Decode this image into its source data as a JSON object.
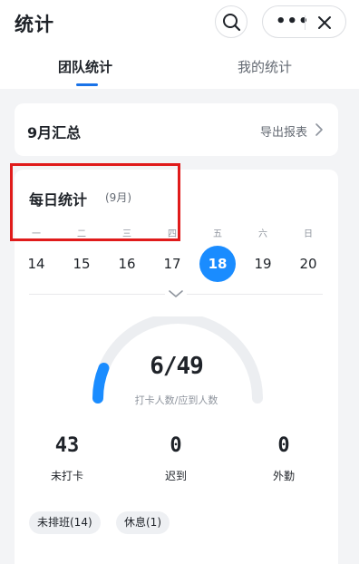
{
  "header": {
    "title": "统计",
    "tabs": [
      {
        "label": "团队统计",
        "active": true
      },
      {
        "label": "我的统计",
        "active": false
      }
    ],
    "more_label": "•••"
  },
  "summary": {
    "title": "9月汇总",
    "export_label": "导出报表"
  },
  "daily": {
    "title": "每日统计",
    "subtitle": "(9月)",
    "weekdays": [
      "一",
      "二",
      "三",
      "四",
      "五",
      "六",
      "日"
    ],
    "dates": [
      "14",
      "15",
      "16",
      "17",
      "18",
      "19",
      "20"
    ],
    "selected_date": "18",
    "ratio": "6/49",
    "ratio_fraction": 0.1224,
    "ratio_label": "打卡人数/应到人数",
    "stats": [
      {
        "value": "43",
        "label": "未打卡"
      },
      {
        "value": "0",
        "label": "迟到"
      },
      {
        "value": "0",
        "label": "外勤"
      }
    ],
    "chips": [
      "未排班(14)",
      "休息(1)"
    ]
  },
  "colors": {
    "accent": "#1a8cff",
    "tab_underline": "#1a73e8",
    "annotation": "#e01b1b",
    "background": "#f3f4f6"
  },
  "icons": [
    "search-icon",
    "more-icon",
    "close-icon",
    "chevron-right-icon",
    "chevron-down-icon"
  ]
}
